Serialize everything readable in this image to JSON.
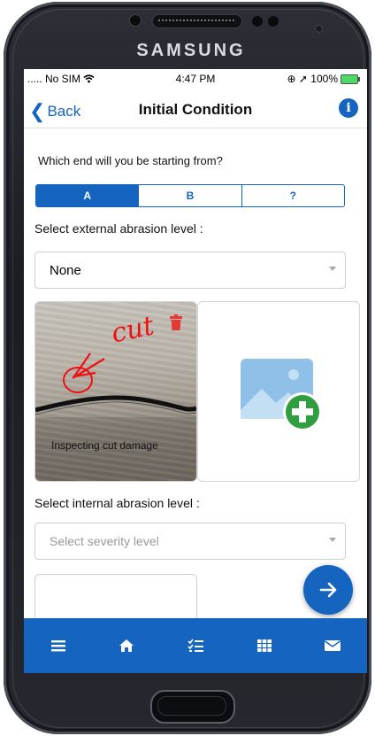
{
  "device": {
    "brand": "SAMSUNG"
  },
  "status_bar": {
    "carrier": "..... No SIM",
    "time": "4:47 PM",
    "battery": "100%"
  },
  "nav": {
    "back_label": "Back",
    "title": "Initial Condition",
    "info_icon": "info-icon"
  },
  "start_question": "Which end will you be starting from?",
  "start_options": [
    "A",
    "B",
    "?"
  ],
  "start_selected": "A",
  "external": {
    "label": "Select external abrasion level :",
    "value": "None"
  },
  "photo": {
    "caption": "Inspecting cut damage",
    "annotation": "cut"
  },
  "internal": {
    "label": "Select internal abrasion level :",
    "placeholder": "Select severity level"
  },
  "tab_bar": {
    "icons": [
      "menu-icon",
      "home-icon",
      "checklist-icon",
      "grid-icon",
      "mail-icon"
    ]
  },
  "colors": {
    "primary": "#1565c0",
    "delete": "#e53935",
    "add": "#2e9e3f"
  }
}
